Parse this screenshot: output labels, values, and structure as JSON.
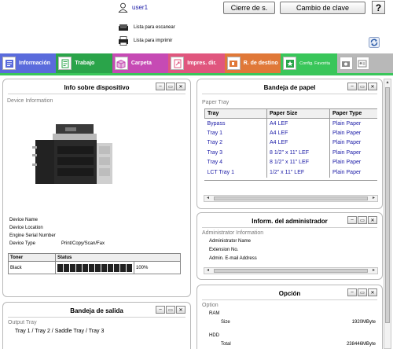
{
  "header": {
    "user_name": "user1",
    "logout_label": "Cierre de s.",
    "password_label": "Cambio de clave",
    "help_label": "?"
  },
  "jobs": {
    "scan_label": "Lista para escanear",
    "print_label": "Lista para imprimir"
  },
  "tabs": [
    {
      "label": "Información",
      "color": "#5a6bdc"
    },
    {
      "label": "Trabajo",
      "color": "#2aa44a"
    },
    {
      "label": "Carpeta",
      "color": "#c64ab4"
    },
    {
      "label": "Impres. dir.",
      "color": "#e0567e"
    },
    {
      "label": "R. de destino",
      "color": "#e07838"
    },
    {
      "label": "Config. Favorita",
      "color": "#39c65a"
    },
    {
      "label": "",
      "color": "#b8b8b8"
    }
  ],
  "device_panel": {
    "title": "Info sobre dispositivo",
    "section": "Device Information",
    "rows": [
      {
        "label": "Device Name",
        "value": ""
      },
      {
        "label": "Device Location",
        "value": ""
      },
      {
        "label": "Engine Serial Number",
        "value": ""
      },
      {
        "label": "Device Type",
        "value": "Print/Copy/Scan/Fax"
      }
    ],
    "toner": {
      "col_toner": "Toner",
      "col_status": "Status",
      "color_name": "Black",
      "level_text": "100%",
      "level": 1.0
    }
  },
  "paper_panel": {
    "title": "Bandeja de papel",
    "section": "Paper Tray",
    "headers": [
      "Tray",
      "Paper Size",
      "Paper Type"
    ],
    "rows": [
      [
        "Bypass",
        "A4 LEF",
        "Plain Paper"
      ],
      [
        "Tray 1",
        "A4 LEF",
        "Plain Paper"
      ],
      [
        "Tray 2",
        "A4 LEF",
        "Plain Paper"
      ],
      [
        "Tray 3",
        "8 1/2\" x 11\" LEF",
        "Plain Paper"
      ],
      [
        "Tray 4",
        "8 1/2\" x 11\" LEF",
        "Plain Paper"
      ],
      [
        "LCT Tray 1",
        "1/2\" x 11\" LEF",
        "Plain Paper"
      ]
    ]
  },
  "admin_panel": {
    "title": "Inform. del administrador",
    "section": "Administrator Information",
    "rows": [
      "Administrator Name",
      "Extension No.",
      "Admin. E-mail Address"
    ]
  },
  "output_panel": {
    "title": "Bandeja de salida",
    "section": "Output Tray",
    "value": "Tray 1 / Tray 2 / Saddle Tray / Tray 3"
  },
  "option_panel": {
    "title": "Opción",
    "section": "Option",
    "ram_label": "RAM",
    "ram_size_label": "Size",
    "ram_size_value": "1920MByte",
    "hdd_label": "HDD",
    "hdd_total_label": "Total",
    "hdd_total_value": "238446MByte"
  }
}
